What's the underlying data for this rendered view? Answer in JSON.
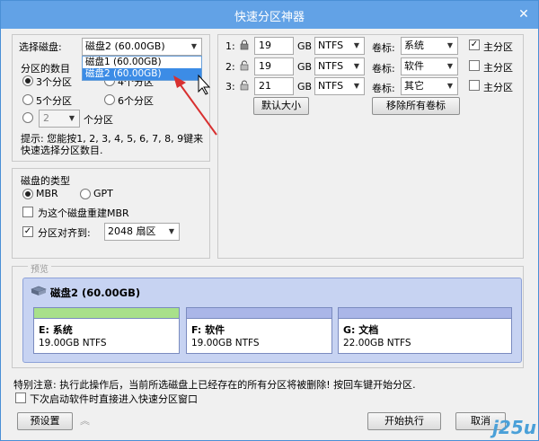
{
  "window": {
    "title": "快速分区神器",
    "close_glyph": "✕"
  },
  "select_disk": {
    "label": "选择磁盘:",
    "value": "磁盘2 (60.00GB)",
    "options": [
      "磁盘1 (60.00GB)",
      "磁盘2 (60.00GB)"
    ],
    "selected_index": 1
  },
  "partition_count": {
    "label": "分区的数目",
    "options": [
      "3个分区",
      "4个分区",
      "5个分区",
      "6个分区"
    ],
    "selected": "3个分区",
    "custom_value": "2",
    "custom_suffix": "个分区",
    "hint": "提示: 您能按1, 2, 3, 4, 5, 6, 7, 8, 9键来快速选择分区数目."
  },
  "disk_type": {
    "title": "磁盘的类型",
    "mbr": "MBR",
    "gpt": "GPT",
    "selected": "MBR",
    "rebuild_label": "为这个磁盘重建MBR",
    "rebuild_checked": false,
    "align_label": "分区对齐到:",
    "align_checked": true,
    "align_value": "2048 扇区"
  },
  "partitions": [
    {
      "index": "1:",
      "size": "19",
      "unit": "GB",
      "fs": "NTFS",
      "label_caption": "卷标:",
      "label": "系统",
      "primary_label": "主分区",
      "primary": true
    },
    {
      "index": "2:",
      "size": "19",
      "unit": "GB",
      "fs": "NTFS",
      "label_caption": "卷标:",
      "label": "软件",
      "primary_label": "主分区",
      "primary": false
    },
    {
      "index": "3:",
      "size": "21",
      "unit": "GB",
      "fs": "NTFS",
      "label_caption": "卷标:",
      "label": "其它",
      "primary_label": "主分区",
      "primary": false
    }
  ],
  "buttons": {
    "default_size": "默认大小",
    "remove_labels": "移除所有卷标",
    "preset": "预设置",
    "start": "开始执行",
    "cancel": "取消"
  },
  "preview": {
    "title": "预览",
    "disk_name": "磁盘2 (60.00GB)",
    "parts": [
      {
        "name": "E: 系统",
        "info": "19.00GB NTFS",
        "color": "#a8e08a"
      },
      {
        "name": "F: 软件",
        "info": "19.00GB NTFS",
        "color": "#aab6e8"
      },
      {
        "name": "G: 文档",
        "info": "22.00GB NTFS",
        "color": "#aab6e8"
      }
    ]
  },
  "notice": "特别注意: 执行此操作后，当前所选磁盘上已经存在的所有分区将被删除! 按回车键开始分区.",
  "startup_option": {
    "label": "下次启动软件时直接进入快速分区窗口",
    "checked": false
  },
  "watermark": "j25u",
  "accent": "#62a2e6"
}
